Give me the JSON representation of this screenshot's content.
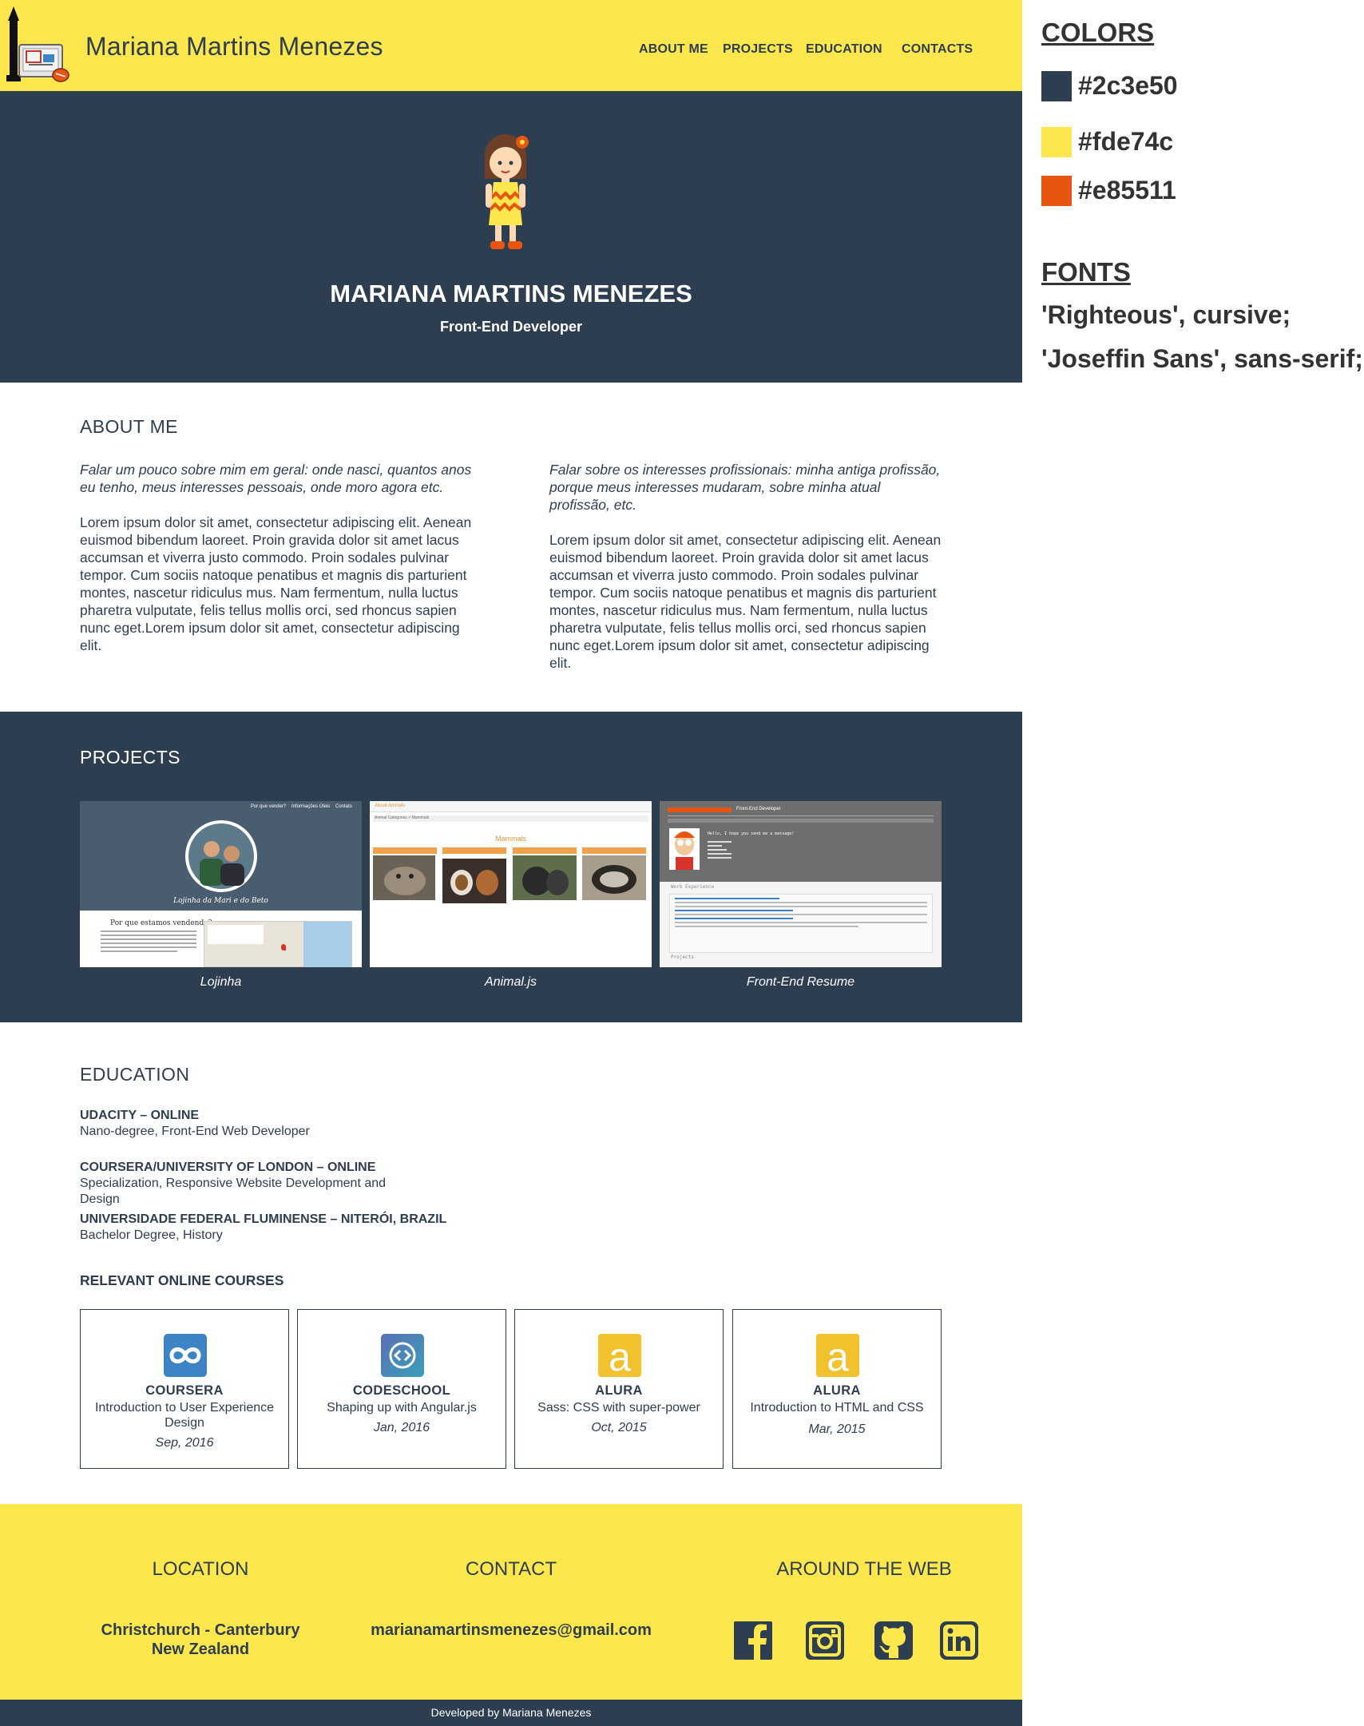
{
  "header": {
    "site_title": "Mariana Martins Menezes",
    "nav": [
      "ABOUT ME",
      "PROJECTS",
      "EDUCATION",
      "CONTACTS"
    ],
    "logo_icon": "desk-computer-logo-icon"
  },
  "hero": {
    "name": "MARIANA MARTINS MENEZES",
    "role": "Front-End Developer",
    "avatar_icon": "girl-avatar-icon"
  },
  "about": {
    "title": "ABOUT ME",
    "columns": [
      {
        "intro": "Falar um pouco sobre mim em geral: onde nasci, quantos anos eu tenho, meus interesses pessoais, onde moro agora etc.",
        "body": "Lorem ipsum dolor sit amet, consectetur adipiscing elit. Aenean euismod bibendum laoreet. Proin gravida dolor sit amet lacus accumsan et viverra justo commodo. Proin sodales pulvinar tempor. Cum sociis natoque penatibus et magnis dis parturient montes, nascetur ridiculus mus. Nam fermentum, nulla luctus pharetra vulputate, felis tellus mollis orci, sed rhoncus sapien nunc eget.Lorem ipsum dolor sit amet, consectetur adipiscing elit."
      },
      {
        "intro": "Falar sobre os interesses profissionais: minha antiga profissão, porque meus interesses mudaram, sobre minha atual profissão, etc.",
        "body": "Lorem ipsum dolor sit amet, consectetur adipiscing elit. Aenean euismod bibendum laoreet. Proin gravida dolor sit amet lacus accumsan et viverra justo commodo. Proin sodales pulvinar tempor. Cum sociis natoque penatibus et magnis dis parturient montes, nascetur ridiculus mus. Nam fermentum, nulla luctus pharetra vulputate, felis tellus mollis orci, sed rhoncus sapien nunc eget.Lorem ipsum dolor sit amet, consectetur adipiscing elit."
      }
    ]
  },
  "projects": {
    "title": "PROJECTS",
    "items": [
      {
        "caption": "Lojinha",
        "thumb": {
          "nav": [
            "Por que vender?",
            "Informações Úteis",
            "Contato"
          ],
          "banner": "Lojinha da Mari e do Beto",
          "heading": "Por que estamos vendendo?"
        }
      },
      {
        "caption": "Animal.js",
        "thumb": {
          "top": "About Animals",
          "crumb": "Animal Categories > Mammals",
          "heading": "Mammals"
        }
      },
      {
        "caption": "Front-End Resume",
        "thumb": {
          "role": "Front-End Developer",
          "hello": "Hello, I hope you send me a message!",
          "section": "Work Experience",
          "footer": "Projects"
        }
      }
    ]
  },
  "education": {
    "title": "EDUCATION",
    "entries": [
      {
        "school": "UDACITY – ONLINE",
        "degree": "Nano-degree, Front-End Web Developer"
      },
      {
        "school": "COURSERA/UNIVERSITY OF LONDON – ONLINE",
        "degree": "Specialization, Responsive Website Development and Design"
      },
      {
        "school": "UNIVERSIDADE FEDERAL FLUMINENSE – NITERÓI, BRAZIL",
        "degree": "Bachelor Degree, History"
      }
    ],
    "courses_title": "RELEVANT ONLINE COURSES",
    "courses": [
      {
        "provider": "COURSERA",
        "name": "Introduction to User Experience Design",
        "date": "Sep, 2016",
        "icon": "coursera-icon",
        "color": "#3d84c6"
      },
      {
        "provider": "CODESCHOOL",
        "name": "Shaping up with Angular.js",
        "date": "Jan, 2016",
        "icon": "codeschool-icon",
        "color": "#4a6fa5"
      },
      {
        "provider": "ALURA",
        "name": "Sass: CSS with super-power",
        "date": "Oct, 2015",
        "icon": "alura-icon",
        "color": "#f2c12e"
      },
      {
        "provider": "ALURA",
        "name": "Introduction to HTML and CSS",
        "date": "Mar, 2015",
        "icon": "alura-icon",
        "color": "#f2c12e"
      }
    ]
  },
  "footer": {
    "location_title": "LOCATION",
    "location_line1": "Christchurch - Canterbury",
    "location_line2": "New Zealand",
    "contact_title": "CONTACT",
    "email": "marianamartinsmenezes@gmail.com",
    "web_title": "AROUND THE WEB",
    "social": [
      "facebook-icon",
      "instagram-icon",
      "github-icon",
      "linkedin-icon"
    ],
    "credit": "Developed by Mariana Menezes"
  },
  "style_guide": {
    "colors_title": "COLORS",
    "colors": [
      "#2c3e50",
      "#fde74c",
      "#e85511"
    ],
    "fonts_title": "FONTS",
    "fonts": [
      "'Righteous', cursive;",
      "'Joseffin Sans', sans-serif;"
    ]
  }
}
